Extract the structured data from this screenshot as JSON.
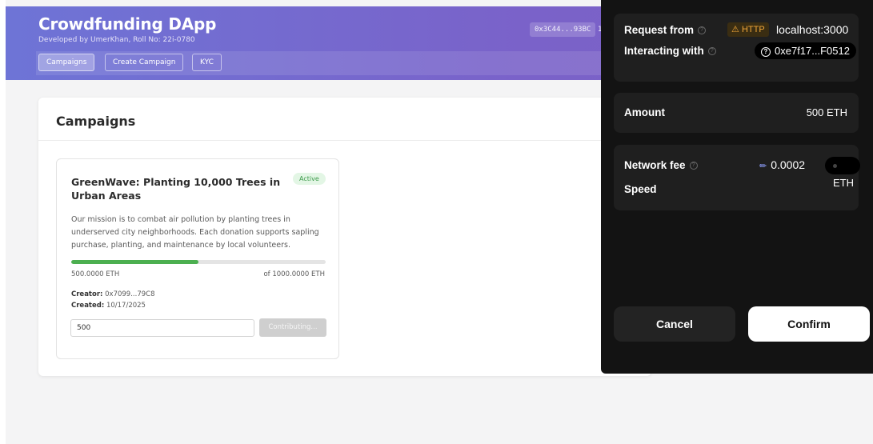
{
  "app": {
    "title": "Crowdfunding DApp",
    "subtitle": "Developed by UmerKhan, Roll No: 22i-0780",
    "account": "0x3C44...93BC",
    "account_extra": "1"
  },
  "nav": {
    "items": [
      {
        "label": "Campaigns",
        "active": true
      },
      {
        "label": "Create Campaign",
        "active": false
      },
      {
        "label": "KYC",
        "active": false
      }
    ]
  },
  "main": {
    "title": "Campaigns"
  },
  "campaign": {
    "title": "GreenWave: Planting 10,000 Trees in Urban Areas",
    "status": "Active",
    "description": "Our mission is to combat air pollution by planting trees in underserved city neighborhoods. Each donation supports sapling purchase, planting, and maintenance by local volunteers.",
    "raised": "500.0000 ETH",
    "goal": "of 1000.0000 ETH",
    "progress_fraction": 0.5,
    "creator_label": "Creator:",
    "creator": "0x7099...79C8",
    "created_label": "Created:",
    "created": "10/17/2025",
    "amount_value": "500",
    "contribute_label": "Contributing..."
  },
  "wallet": {
    "request_from_label": "Request from",
    "http_tag": "HTTP",
    "origin": "localhost:3000",
    "interacting_label": "Interacting with",
    "contract": "0xe7f17...F0512",
    "amount_label": "Amount",
    "amount_value": "500 ETH",
    "fee_label": "Network fee",
    "fee_value": "0.0002",
    "fee_unit": "ETH",
    "speed_label": "Speed",
    "cancel_label": "Cancel",
    "confirm_label": "Confirm"
  },
  "colors": {
    "header_gradient_start": "#6e74d6",
    "header_gradient_end": "#7d5fc4",
    "progress_fill": "#4caf50",
    "active_badge_bg": "#e3f6e5",
    "active_badge_text": "#3e9a4c",
    "wallet_bg": "#131313",
    "http_warning": "#f1a638"
  }
}
